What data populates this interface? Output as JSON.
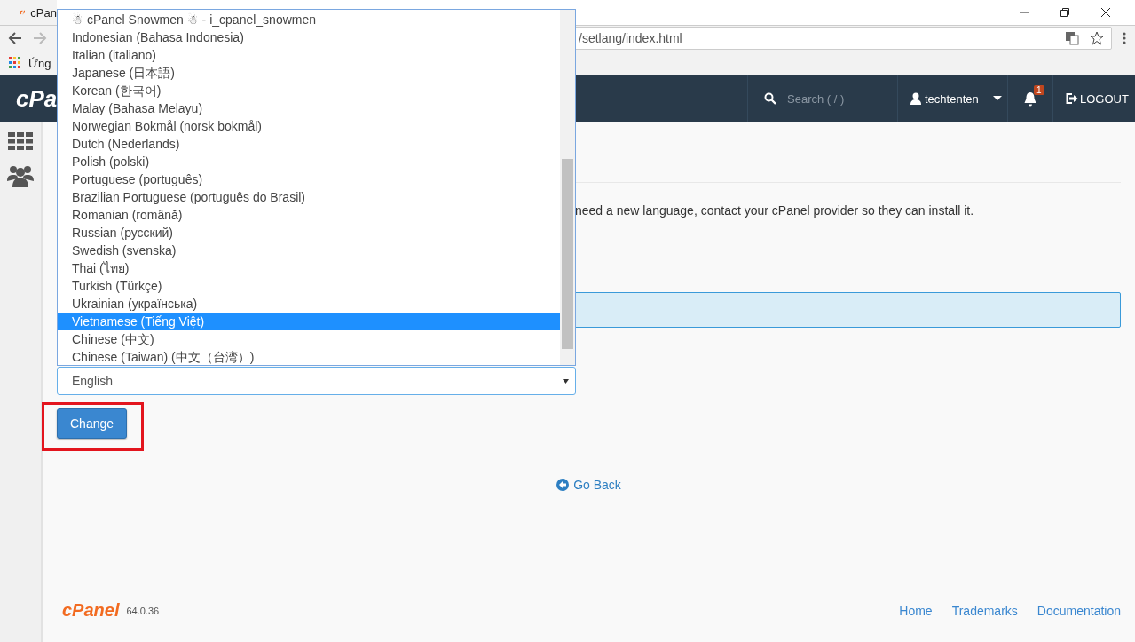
{
  "browser": {
    "tab": {
      "title": "cPan"
    },
    "address": {
      "value": "/setlang/index.html"
    },
    "bookmarks": [
      {
        "label": "Ứng"
      }
    ]
  },
  "header": {
    "logo": "cPa",
    "search": {
      "placeholder": "Search ( / )"
    },
    "user": "techtenten",
    "notifications": {
      "count": "1"
    },
    "logout": "LOGOUT"
  },
  "content": {
    "intro_text": "need a new language, contact your cPanel provider so they can install it.",
    "language_select": {
      "value": "English",
      "open": true,
      "options": [
        {
          "label": "☃ cPanel Snowmen ☃ - i_cpanel_snowmen",
          "selected": false
        },
        {
          "label": "Indonesian (Bahasa Indonesia)",
          "selected": false
        },
        {
          "label": "Italian (italiano)",
          "selected": false
        },
        {
          "label": "Japanese (日本語)",
          "selected": false
        },
        {
          "label": "Korean (한국어)",
          "selected": false
        },
        {
          "label": "Malay (Bahasa Melayu)",
          "selected": false
        },
        {
          "label": "Norwegian Bokmål (norsk bokmål)",
          "selected": false
        },
        {
          "label": "Dutch (Nederlands)",
          "selected": false
        },
        {
          "label": "Polish (polski)",
          "selected": false
        },
        {
          "label": "Portuguese (português)",
          "selected": false
        },
        {
          "label": "Brazilian Portuguese (português do Brasil)",
          "selected": false
        },
        {
          "label": "Romanian (română)",
          "selected": false
        },
        {
          "label": "Russian (русский)",
          "selected": false
        },
        {
          "label": "Swedish (svenska)",
          "selected": false
        },
        {
          "label": "Thai (ไทย)",
          "selected": false
        },
        {
          "label": "Turkish (Türkçe)",
          "selected": false
        },
        {
          "label": "Ukrainian (українська)",
          "selected": false
        },
        {
          "label": "Vietnamese (Tiếng Việt)",
          "selected": true
        },
        {
          "label": "Chinese (中文)",
          "selected": false
        },
        {
          "label": "Chinese (Taiwan) (中文（台湾）)",
          "selected": false
        }
      ]
    },
    "change_button": "Change",
    "go_back": "Go Back"
  },
  "footer": {
    "logo": "cPanel",
    "version": "64.0.36",
    "links": [
      "Home",
      "Trademarks",
      "Documentation"
    ]
  }
}
